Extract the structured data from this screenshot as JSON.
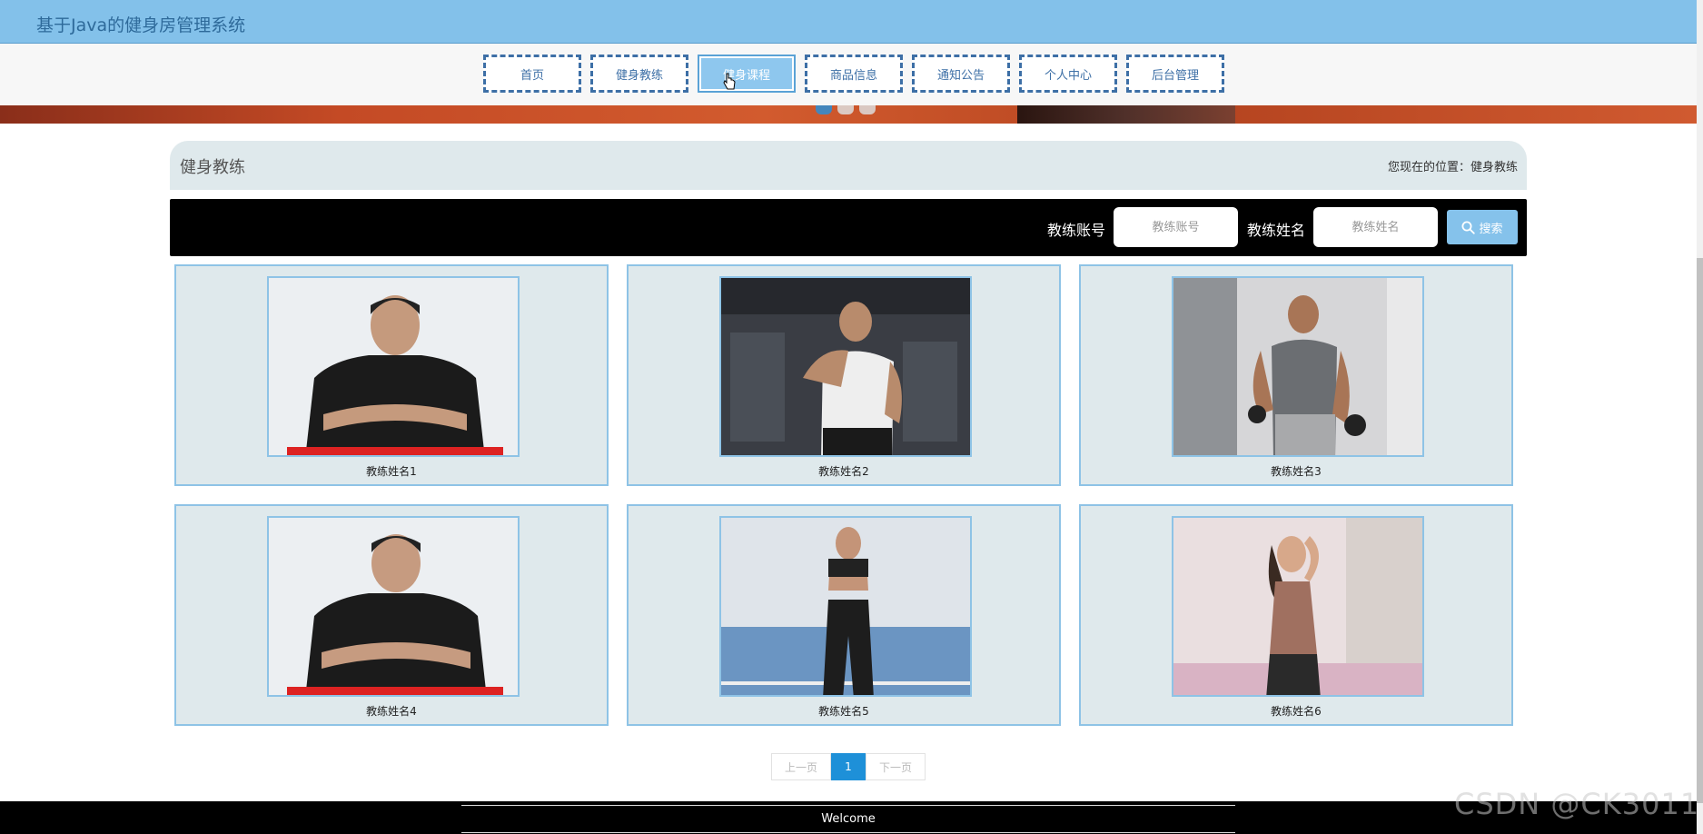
{
  "app": {
    "title": "基于Java的健身房管理系统"
  },
  "nav": {
    "items": [
      {
        "label": "首页"
      },
      {
        "label": "健身教练"
      },
      {
        "label": "健身课程"
      },
      {
        "label": "商品信息"
      },
      {
        "label": "通知公告"
      },
      {
        "label": "个人中心"
      },
      {
        "label": "后台管理"
      }
    ],
    "active_index": 2
  },
  "section": {
    "heading": "健身教练",
    "location_text": "您现在的位置：健身教练"
  },
  "search": {
    "account_label": "教练账号",
    "account_placeholder": "教练账号",
    "name_label": "教练姓名",
    "name_placeholder": "教练姓名",
    "button_label": "搜索",
    "button_icon": "search-icon"
  },
  "coaches": [
    {
      "name": "教练姓名1"
    },
    {
      "name": "教练姓名2"
    },
    {
      "name": "教练姓名3"
    },
    {
      "name": "教练姓名4"
    },
    {
      "name": "教练姓名5"
    },
    {
      "name": "教练姓名6"
    }
  ],
  "pagination": {
    "prev": "上一页",
    "current": "1",
    "next": "下一页"
  },
  "footer": {
    "text": "Welcome"
  },
  "watermark": "CSDN @CK3011",
  "colors": {
    "header": "#83c1ea",
    "nav_border": "#3d6fa6",
    "card_bg": "#dfe9ec",
    "card_border": "#8ec3e6",
    "active_page": "#1e90d8"
  }
}
